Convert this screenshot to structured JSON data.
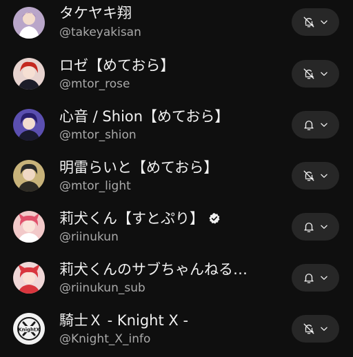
{
  "channels": [
    {
      "name": "タケヤキ翔",
      "handle": "@takeyakisan",
      "verified": false,
      "bell": "bell-off-icon",
      "avatar_bg": "#b9a6c9",
      "avatar_fg": "#7a4aa0"
    },
    {
      "name": "ロゼ【めておら】",
      "handle": "@mtor_rose",
      "verified": false,
      "bell": "bell-off-icon",
      "avatar_bg": "#e7d3cf",
      "avatar_fg": "#c4281f"
    },
    {
      "name": "心音 / Shion【めておら】",
      "handle": "@mtor_shion",
      "verified": false,
      "bell": "bell-icon",
      "avatar_bg": "#5b4fb0",
      "avatar_fg": "#2a1f6e"
    },
    {
      "name": "明雷らいと【めておら】",
      "handle": "@mtor_light",
      "verified": false,
      "bell": "bell-off-icon",
      "avatar_bg": "#c8b37a",
      "avatar_fg": "#2a2a28"
    },
    {
      "name": "莉犬くん【すとぷり】",
      "handle": "@riinukun",
      "verified": true,
      "bell": "bell-icon",
      "avatar_bg": "#f2c9c9",
      "avatar_fg": "#e0506a"
    },
    {
      "name": "莉犬くんのサブちゃんねる…",
      "handle": "@riinukun_sub",
      "verified": false,
      "bell": "bell-icon",
      "avatar_bg": "#f0d7d7",
      "avatar_fg": "#d9363e"
    },
    {
      "name": "騎士Ｘ - Knight X -",
      "handle": "@Knight_X_info",
      "verified": false,
      "bell": "bell-off-icon",
      "avatar_bg": "#f2f2f2",
      "avatar_fg": "#1a1a1a",
      "avatar_text": "KnightX"
    }
  ]
}
